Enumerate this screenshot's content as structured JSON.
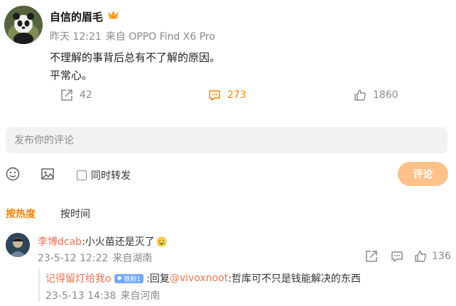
{
  "post": {
    "username": "自信的眉毛",
    "time": "昨天 12:21",
    "source": "来自 OPPO Find X6 Pro",
    "lines": [
      "不理解的事背后总有不了解的原因。",
      "平常心。"
    ],
    "reposts": "42",
    "comments": "273",
    "likes": "1860",
    "vip_badge_icon": "crown-icon",
    "accent": "#ff8200"
  },
  "composer": {
    "placeholder": "发布你的评论",
    "repost_label": "同时转发",
    "submit_label": "评论"
  },
  "sort": {
    "hot": "按热度",
    "time": "按时间"
  },
  "comment": {
    "name": "李博dcab",
    "text": ":小火苗还是灭了",
    "emoji": "crying-face-icon",
    "date": "23-5-12 12:22",
    "location": "来自湖南",
    "likes": "136"
  },
  "reply": {
    "name": "记得留灯给我o",
    "badge": "铁粉1",
    "prefix": ":回复",
    "mention": "@vivoxnoot",
    "text": ":哲库可不只是钱能解决的东西",
    "date": "23-5-13 14:38",
    "location": "来自河南"
  }
}
